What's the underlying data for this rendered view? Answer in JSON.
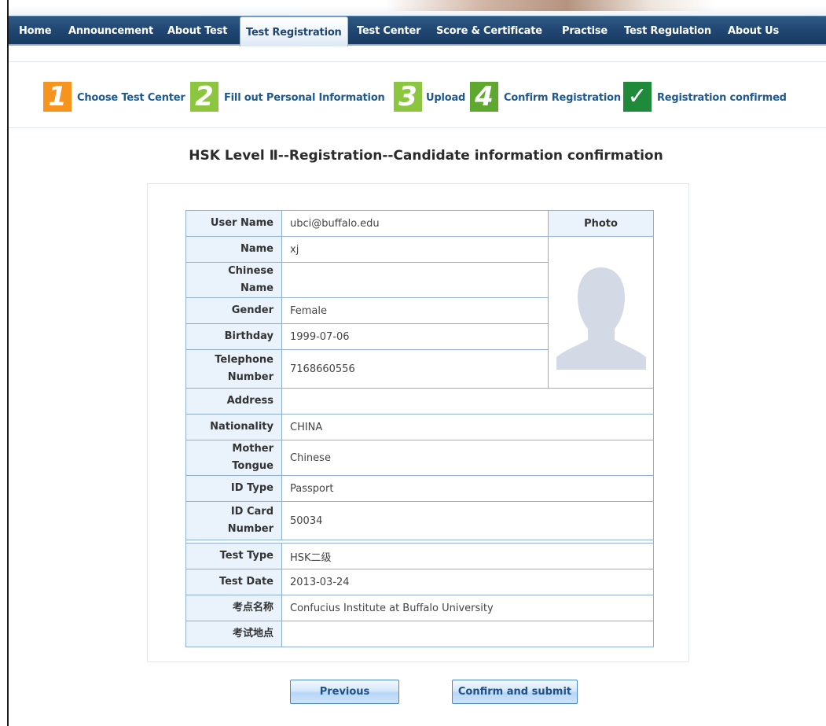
{
  "nav": {
    "items": [
      {
        "label": "Home"
      },
      {
        "label": "Announcement"
      },
      {
        "label": "About Test"
      },
      {
        "label": "Test Registration",
        "active": true
      },
      {
        "label": "Test Center"
      },
      {
        "label": "Score & Certificate"
      },
      {
        "label": "Practise"
      },
      {
        "label": "Test Regulation"
      },
      {
        "label": "About Us"
      }
    ]
  },
  "steps": [
    {
      "number": "1",
      "label": "Choose Test Center",
      "color": "#f7941d"
    },
    {
      "number": "2",
      "label": "Fill out Personal Information",
      "color": "#8cc63f"
    },
    {
      "number": "3",
      "label": "Upload",
      "color": "#8cc63f"
    },
    {
      "number": "4",
      "label": "Confirm Registration",
      "color": "#5fa82f"
    },
    {
      "number": "✓",
      "label": "Registration confirmed",
      "color": "#1f8a3a"
    }
  ],
  "page": {
    "title": "HSK Level Ⅱ--Registration--Candidate information confirmation"
  },
  "form": {
    "photo_label": "Photo",
    "rows": [
      {
        "label": "User Name",
        "value": "ubci@buffalo.edu"
      },
      {
        "label": "Name",
        "value": "xj"
      },
      {
        "label": "Chinese Name",
        "value": ""
      },
      {
        "label": "Gender",
        "value": "Female"
      },
      {
        "label": "Birthday",
        "value": "1999-07-06"
      },
      {
        "label": "Telephone Number",
        "value": "7168660556"
      },
      {
        "label": "Address",
        "value": ""
      },
      {
        "label": "Nationality",
        "value": "CHINA"
      },
      {
        "label": "Mother Tongue",
        "value": "Chinese"
      },
      {
        "label": "ID Type",
        "value": "Passport"
      },
      {
        "label": "ID Card Number",
        "value": "50034"
      },
      {
        "label": "Test Type",
        "value": "HSK二级"
      },
      {
        "label": "Test Date",
        "value": "2013-03-24"
      },
      {
        "label": "考点名称",
        "value": "Confucius Institute at Buffalo University"
      },
      {
        "label": "考试地点",
        "value": ""
      }
    ]
  },
  "buttons": {
    "previous": "Previous",
    "submit": "Confirm and submit"
  }
}
